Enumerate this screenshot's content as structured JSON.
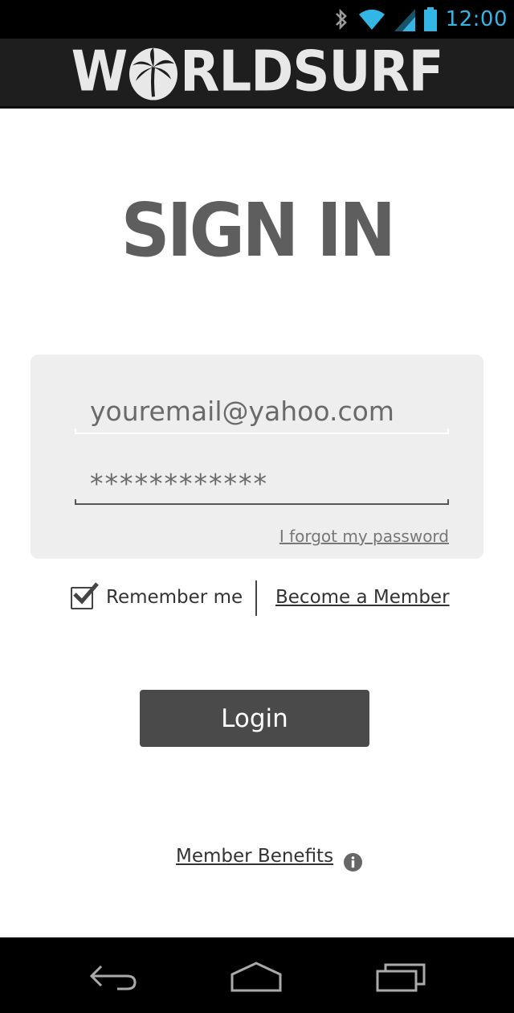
{
  "status_bar": {
    "time": "12:00",
    "icons": [
      "bluetooth-icon",
      "wifi-icon",
      "signal-icon",
      "battery-icon"
    ],
    "accent_color": "#33b5e5"
  },
  "app_bar": {
    "logo_text_left": "W",
    "logo_text_right": "RLDSURF"
  },
  "page_title": "SIGN IN",
  "form": {
    "email_value": "youremail@yahoo.com",
    "password_value": "************",
    "forgot_password_label": "I forgot my password"
  },
  "options": {
    "remember_me_label": "Remember me",
    "remember_me_checked": true,
    "become_member_label": "Become a Member"
  },
  "login_button_label": "Login",
  "member_benefits_label": "Member Benefits",
  "nav_bar": {
    "icons": [
      "back-icon",
      "home-icon",
      "recent-apps-icon"
    ]
  },
  "colors": {
    "button_bg": "#4a4a4a",
    "card_bg": "#eeeeee",
    "title_color": "#5e5e5e"
  }
}
